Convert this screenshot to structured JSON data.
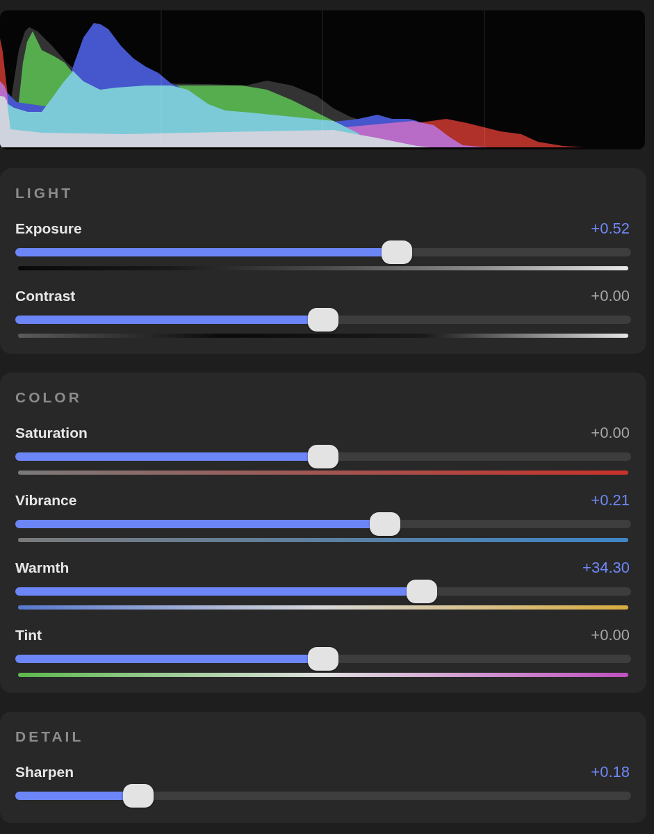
{
  "sections": [
    {
      "title": "LIGHT",
      "sliders": [
        {
          "label": "Exposure",
          "value": "+0.52",
          "modified": true,
          "level": 0.62,
          "kind": "luminance"
        },
        {
          "label": "Contrast",
          "value": "+0.00",
          "modified": false,
          "level": 0.5,
          "kind": "contrast"
        }
      ]
    },
    {
      "title": "COLOR",
      "sliders": [
        {
          "label": "Saturation",
          "value": "+0.00",
          "modified": false,
          "level": 0.5,
          "kind": "saturation"
        },
        {
          "label": "Vibrance",
          "value": "+0.21",
          "modified": true,
          "level": 0.6,
          "kind": "vibrance"
        },
        {
          "label": "Warmth",
          "value": "+34.30",
          "modified": true,
          "level": 0.66,
          "kind": "temperature"
        },
        {
          "label": "Tint",
          "value": "+0.00",
          "modified": false,
          "level": 0.5,
          "kind": "tint"
        }
      ]
    },
    {
      "title": "DETAIL",
      "sliders": [
        {
          "label": "Sharpen",
          "value": "+0.18",
          "modified": true,
          "level": 0.2,
          "kind": "plain"
        }
      ]
    }
  ]
}
